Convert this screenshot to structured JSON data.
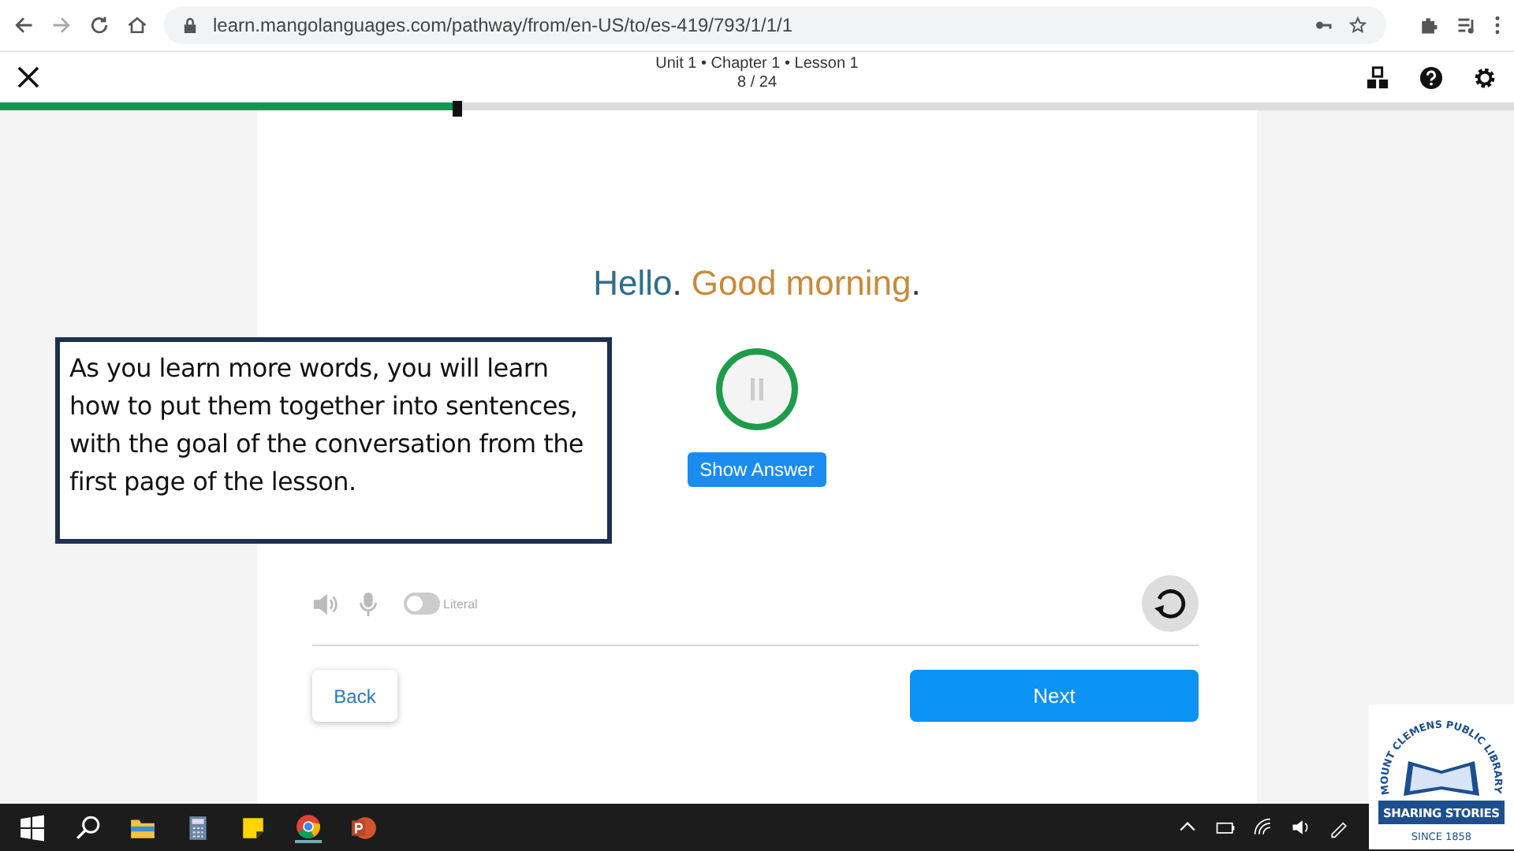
{
  "browser": {
    "url": "learn.mangolanguages.com/pathway/from/en-US/to/es-419/793/1/1/1"
  },
  "header": {
    "title": "Unit 1 • Chapter 1 • Lesson 1",
    "counter": "8 / 24"
  },
  "progress": {
    "level": 0.3
  },
  "phrase": [
    {
      "text": "Hello",
      "color": "#2f6f8e",
      "end": "."
    },
    {
      "text": "Good morning",
      "color": "#c88a3c",
      "end": "."
    }
  ],
  "show_answer": "Show Answer",
  "literal_toggle": {
    "label": "Literal",
    "on": false
  },
  "buttons": {
    "back": "Back",
    "next": "Next"
  },
  "callout": "As you learn more words, you will learn how to put them together into sentences, with the goal of the conversation from the first page of the lesson.",
  "logo": {
    "arc": "MOUNT CLEMENS PUBLIC LIBRARY",
    "banner": "SHARING STORIES",
    "since": "SINCE 1858"
  }
}
